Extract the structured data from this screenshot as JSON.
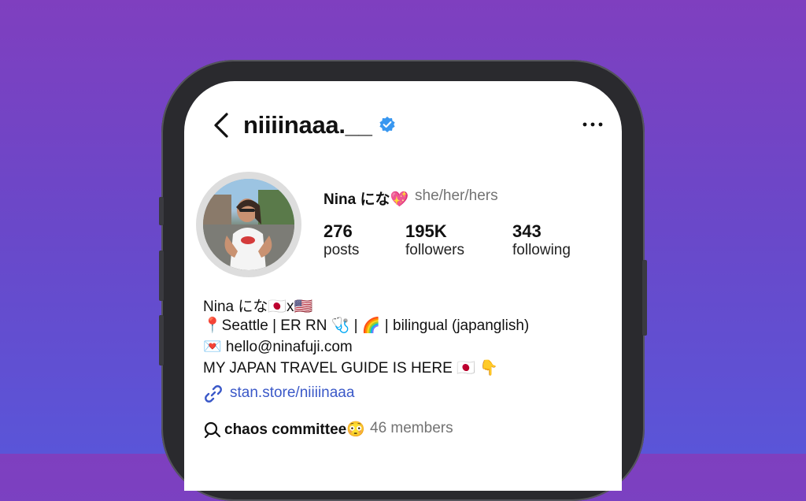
{
  "header": {
    "username": "niiiinaaa.__",
    "back_icon": "chevron-left-icon",
    "verified_icon": "verified-badge-icon",
    "more_icon": "more-horizontal-icon"
  },
  "profile": {
    "name": "Nina にな💖",
    "pronouns": "she/her/hers",
    "stats": [
      {
        "value": "276",
        "label": "posts"
      },
      {
        "value": "195K",
        "label": "followers"
      },
      {
        "value": "343",
        "label": "following"
      }
    ]
  },
  "bio": {
    "lines": [
      "Nina にな🇯🇵x🇺🇸",
      "📍Seattle | ER RN 🩺 | 🌈 | bilingual (japanglish)",
      "💌 hello@ninafuji.com",
      "MY JAPAN TRAVEL GUIDE IS HERE 🇯🇵 👇"
    ],
    "link": "stan.store/niiiinaaa",
    "link_icon": "link-icon"
  },
  "broadcast": {
    "name": "chaos committee😳",
    "members": "46 members",
    "icon": "broadcast-channel-icon"
  },
  "colors": {
    "verified": "#3897f0",
    "link": "#3b59c8",
    "secondary_text": "#737373"
  }
}
